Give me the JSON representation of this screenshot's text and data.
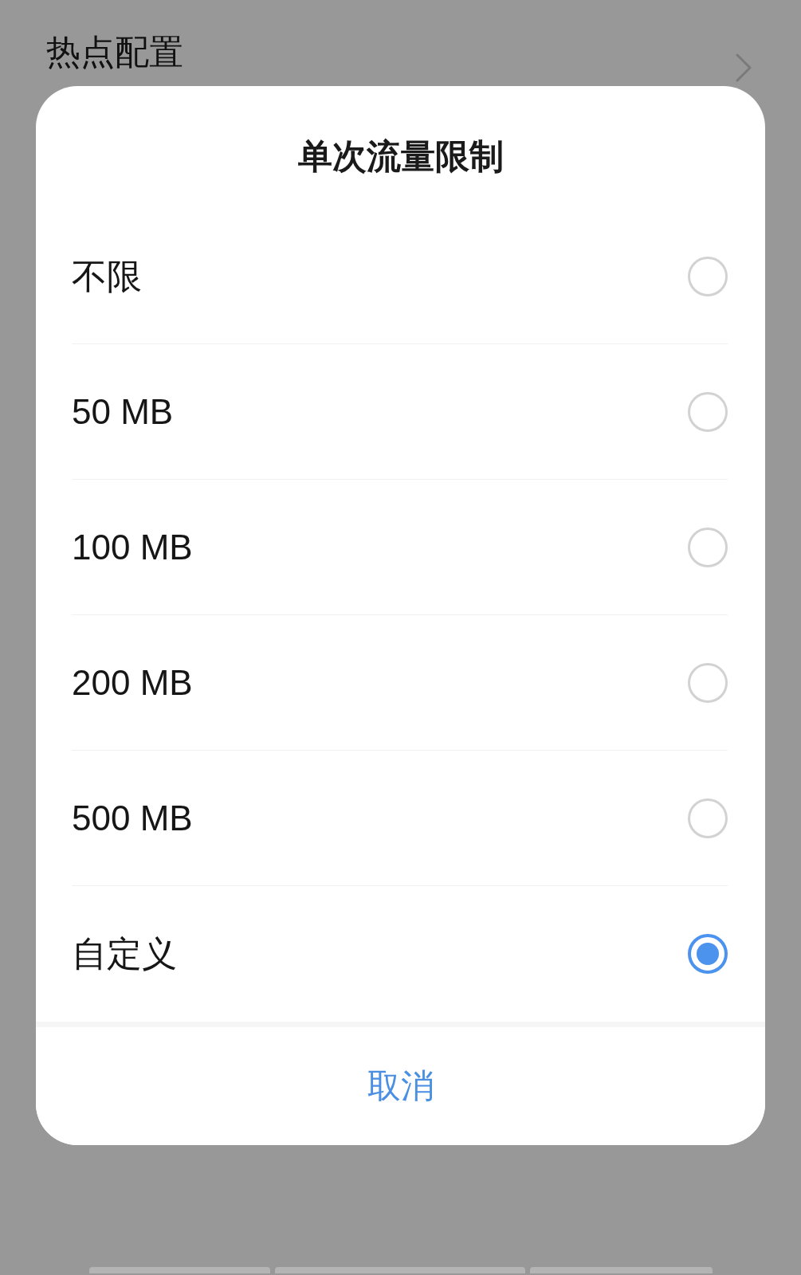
{
  "background_page": {
    "title": "热点配置"
  },
  "dialog": {
    "title": "单次流量限制",
    "options": [
      {
        "label": "不限",
        "selected": false
      },
      {
        "label": "50 MB",
        "selected": false
      },
      {
        "label": "100 MB",
        "selected": false
      },
      {
        "label": "200 MB",
        "selected": false
      },
      {
        "label": "500 MB",
        "selected": false
      },
      {
        "label": "自定义",
        "selected": true
      }
    ],
    "cancel_button": "取消"
  }
}
